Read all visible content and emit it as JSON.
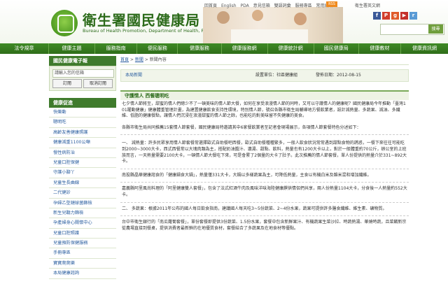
{
  "header": {
    "site_title": "衛生署國民健康局",
    "site_subtitle": "Bureau of Health Promotion, Department of Health, R.O.C. (Taiwan)",
    "top_links": [
      "回首頁",
      "English",
      "PDA",
      "意見信箱",
      "雙語詞彙",
      "服務專區",
      "常用網站"
    ],
    "rss_label": "RSS",
    "english_link": "衛生署英文網",
    "social": [
      {
        "letter": "f",
        "color": "#3b5998"
      },
      {
        "letter": "P",
        "color": "#d23d2c"
      },
      {
        "letter": "g",
        "color": "#e05b2a"
      },
      {
        "letter": "▶",
        "color": "#c4302b"
      },
      {
        "letter": "r",
        "color": "#5a9bd5"
      }
    ],
    "search_button": "搜尋"
  },
  "nav": [
    "法令規章",
    "健康主題",
    "服務指南",
    "便民服務",
    "健康服務",
    "健康服務網",
    "健康統計網",
    "國民健康局",
    "健康教材",
    "健康資訊網"
  ],
  "sidebar": {
    "search_title": "國民健康電子報",
    "search_placeholder": "請輸入您的信箱",
    "subscribe_label": "訂閱",
    "unsubscribe_label": "取消訂閱",
    "health_title": "健康促進",
    "items": [
      "快樂動",
      "聰明吃",
      "高齡友善健康照護",
      "健康減重1100公噸",
      "慢性病防治",
      "兒童口腔保健",
      "守護小腳丫",
      "兒童生長曲線",
      "二代健診",
      "孕婦乙型鏈球菌篩檢",
      "新生兒聽力篩檢",
      "孕產婦身心關懷中心",
      "兒童口腔照護",
      "兒童預防保健服務",
      "手冊專區",
      "寶寶爬爬樂",
      "本局健康諮詢"
    ]
  },
  "main": {
    "breadcrumb": [
      "首頁",
      "新聞",
      "新聞內容"
    ],
    "print_link": "本局新聞",
    "unit_label": "設置單位：社區健康組",
    "date_label": "發佈日期：2012-08-15",
    "article_title": "守護情人 西餐聰明吃",
    "paragraphs": [
      "七夕情人節將至，甜蜜的情人們總少不了一頓美味的情人節大餐，如何在享受浪漫情人節的同時，又可以守護情人的健康呢？國民健康局今年推動「臺灣101躍動健康」健康體重管理計畫，為建置健康飲食支持性環境，特別情人節，號召各縣市衛生局輔導地方餐飲業者，設計減熱量、多蔬果、減油、多纖維、低脂的健康餐點，讓情人們沉浸在浪漫甜蜜的情人節之餘，也能吃的對美味留不失健康的美食。",
      "各縣市衛生局共同推薦15套情人節套餐，國民健康局特邀請其中6家餐飲業者至記者會現場展示，各項情人節套餐特色分述如下：",
      "一、 減熱量：許多民眾享用情人節套餐常選擇歐式自助餐吧西餐，歐式自助餐種種繁多，一般人飲食狀況常常遇到甜點食物的誘惑，一餐下來往往可能吃到2000~3000大卡，西式西餐常以大塊肉類為主，搭配奶油醬汁、濃湯、甜點、飲料，熱量也有1200大卡以上，對於一般體重約70公斤，辦公室的上班族而言，一天熱量需要2100大卡，一頓情人節大餐吃下來，可是會累了2個量的大卡了肚子。此次推薦的情人節套餐，單人份提供的熱量介於331~892大卡。",
      "南投縣晶華健康諮食的「健康鍋食大鍋」，熱量僅331大卡，大鍋以多樣蔬果為主，可降低熱量，主食以有機白米及雜米混和增加纖維。",
      "嘉義縣阿里風尚料理的「阿里健康雙人套餐」，包含了法式紅酒牛肉及風味洋味海陸健康饌供情侶們共享，兩人份熱量1104大卡，分食後一人熱量約552大卡。",
      "二、 多蔬果：根據2011年公布的國人每日飲食指南，建議國人每天吃3~5份蔬菜、2~4份水果，蔬果可提供許多膳食纖維、維生素、礦物質。",
      "台中市衛生銀行的「南瓜蘿蔔套餐」，單份套餐即提供3份蔬菜、1.5份水果，套餐中包含新鮮果汁、有機蔬果生菜沙拉、時蔬熱湯、華燒時蔬，且菜餚新宗從農場直接到餐桌，提供消費者最新鮮的在地優質食材，套餐結合了多蔬果及在地食材等優點。"
    ]
  }
}
